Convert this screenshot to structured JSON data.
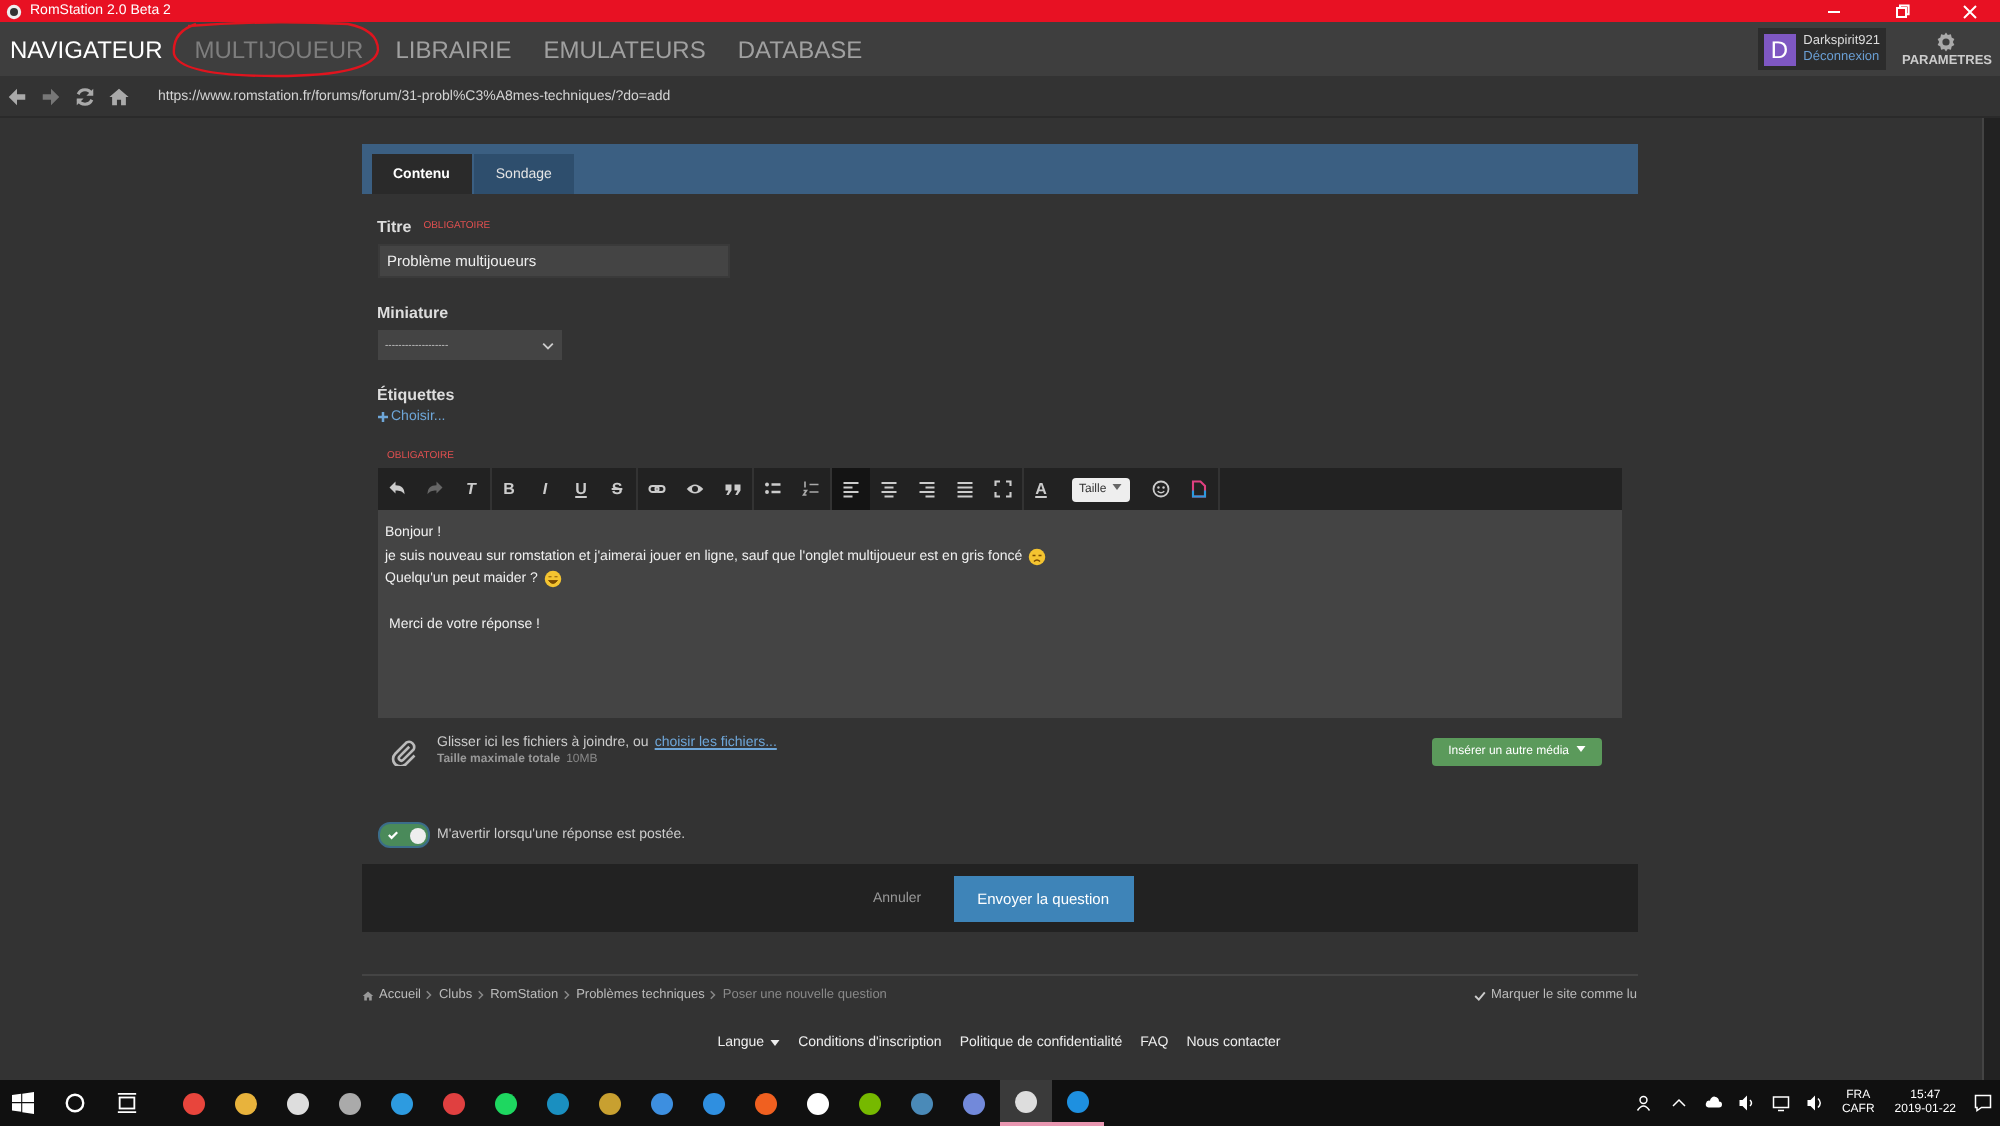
{
  "window": {
    "title": "RomStation 2.0 Beta 2"
  },
  "nav": {
    "tabs": [
      {
        "label": "NAVIGATEUR",
        "selected": true,
        "disabled": false
      },
      {
        "label": "MULTIJOUEUR",
        "selected": false,
        "disabled": true
      },
      {
        "label": "LIBRAIRIE",
        "selected": false,
        "disabled": false
      },
      {
        "label": "EMULATEURS",
        "selected": false,
        "disabled": false
      },
      {
        "label": "DATABASE",
        "selected": false,
        "disabled": false
      }
    ],
    "user": {
      "avatar_letter": "D",
      "name": "Darkspirit921",
      "logout": "Déconnexion"
    },
    "settings": "PARAMETRES"
  },
  "address_bar": {
    "url": "https://www.romstation.fr/forums/forum/31-probl%C3%A8mes-techniques/?do=add"
  },
  "form": {
    "tabs": [
      {
        "label": "Contenu",
        "selected": true
      },
      {
        "label": "Sondage",
        "selected": false
      }
    ],
    "title_label": "Titre",
    "required": "OBLIGATOIRE",
    "title_value": "Problème multijoueurs",
    "thumbnail_label": "Miniature",
    "thumbnail_value": "-------------------",
    "tags_label": "Étiquettes",
    "tags_link": "Choisir...",
    "editor_required": "OBLIGATOIRE",
    "toolbar": {
      "clear": "T",
      "formats": [
        "B",
        "I",
        "U",
        "S"
      ],
      "align": [
        {
          "selected": true
        },
        {
          "selected": false
        },
        {
          "selected": false
        },
        {
          "selected": false
        }
      ],
      "text_color_letter": "A",
      "size": "Taille"
    },
    "body": [
      {
        "kind": "plain",
        "text": "Bonjour !"
      },
      {
        "kind": "sad",
        "text": "je suis nouveau sur romstation et j'aimerai jouer en ligne, sauf que l'onglet multijoueur est en gris foncé"
      },
      {
        "kind": "grin",
        "text": "Quelqu'un peut maider ?"
      },
      {
        "kind": "paragraph",
        "text": "Merci de votre réponse !"
      }
    ],
    "attach_text": "Glisser ici les fichiers à joindre, ou",
    "attach_link": "choisir les fichiers...",
    "max_label": "Taille maximale totale",
    "max_value": "10MB",
    "media_button": "Insérer un autre média",
    "notify": {
      "on": true,
      "label": "M'avertir lorsqu'une réponse est postée."
    },
    "cancel": "Annuler",
    "submit": "Envoyer la question"
  },
  "breadcrumb": {
    "items": [
      "Accueil",
      "Clubs",
      "RomStation",
      "Problèmes techniques"
    ],
    "current": "Poser une nouvelle question",
    "mark_read": "Marquer le site comme lu"
  },
  "footer": {
    "language": "Langue",
    "links": [
      "Conditions d'inscription",
      "Politique de confidentialité",
      "FAQ",
      "Nous contacter"
    ]
  },
  "taskbar": {
    "apps": [
      {
        "color": "#e8453c",
        "selected": false,
        "running": false
      },
      {
        "color": "#e8b33c",
        "selected": false,
        "running": false
      },
      {
        "color": "#dddddd",
        "selected": false,
        "running": false
      },
      {
        "color": "#aaaaaa",
        "selected": false,
        "running": false
      },
      {
        "color": "#2d9be0",
        "selected": false,
        "running": false
      },
      {
        "color": "#e04040",
        "selected": false,
        "running": false
      },
      {
        "color": "#1ed760",
        "selected": false,
        "running": false
      },
      {
        "color": "#1a8fc0",
        "selected": false,
        "running": false
      },
      {
        "color": "#c8a030",
        "selected": false,
        "running": false
      },
      {
        "color": "#3d8fe0",
        "selected": false,
        "running": false
      },
      {
        "color": "#2f8fe0",
        "selected": false,
        "running": false
      },
      {
        "color": "#f06020",
        "selected": false,
        "running": false
      },
      {
        "color": "#ffffff",
        "selected": false,
        "running": false
      },
      {
        "color": "#76b900",
        "selected": false,
        "running": false
      },
      {
        "color": "#4a8ab8",
        "selected": false,
        "running": false
      },
      {
        "color": "#7289da",
        "selected": false,
        "running": false
      },
      {
        "color": "#dddddd",
        "selected": true,
        "running": true
      },
      {
        "color": "#1e90e0",
        "selected": false,
        "running": true
      }
    ],
    "lang": "FRA",
    "layout": "CAFR",
    "time": "15:47",
    "date": "2019-01-22"
  }
}
